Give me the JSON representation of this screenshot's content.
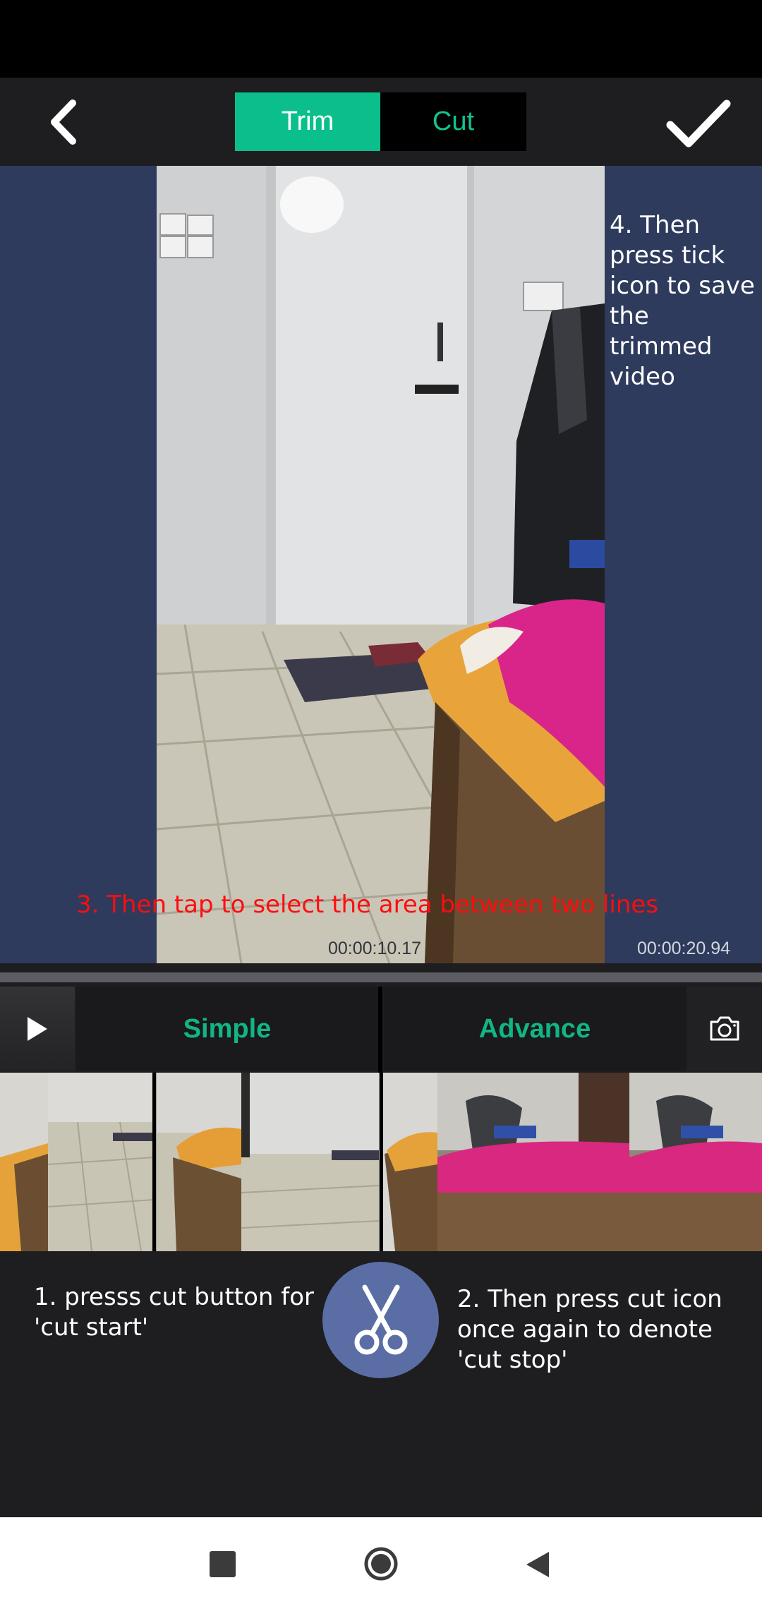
{
  "toolbar": {
    "back_icon": "chevron-left-icon",
    "tabs": {
      "trim": "Trim",
      "cut": "Cut"
    },
    "confirm_icon": "checkmark-icon",
    "accent_color": "#0bbf8c"
  },
  "preview": {
    "instruction_step4": "4. Then press tick icon to save the trimmed video",
    "instruction_step3": "3. Then tap to select the area between two lines",
    "current_time": "00:00:10.17",
    "total_time": "00:00:20.94",
    "background_color": "#2e3b5d"
  },
  "modes": {
    "play_icon": "play-icon",
    "simple": "Simple",
    "advance": "Advance",
    "camera_icon": "camera-icon"
  },
  "bottom": {
    "instruction_step1": "1. presss cut button for 'cut start'",
    "instruction_step2": "2. Then press cut icon once again to denote 'cut stop'",
    "scissor_icon": "scissors-icon"
  },
  "navbar": {
    "recents_icon": "square-icon",
    "home_icon": "circle-home-icon",
    "back_icon": "triangle-back-icon"
  }
}
